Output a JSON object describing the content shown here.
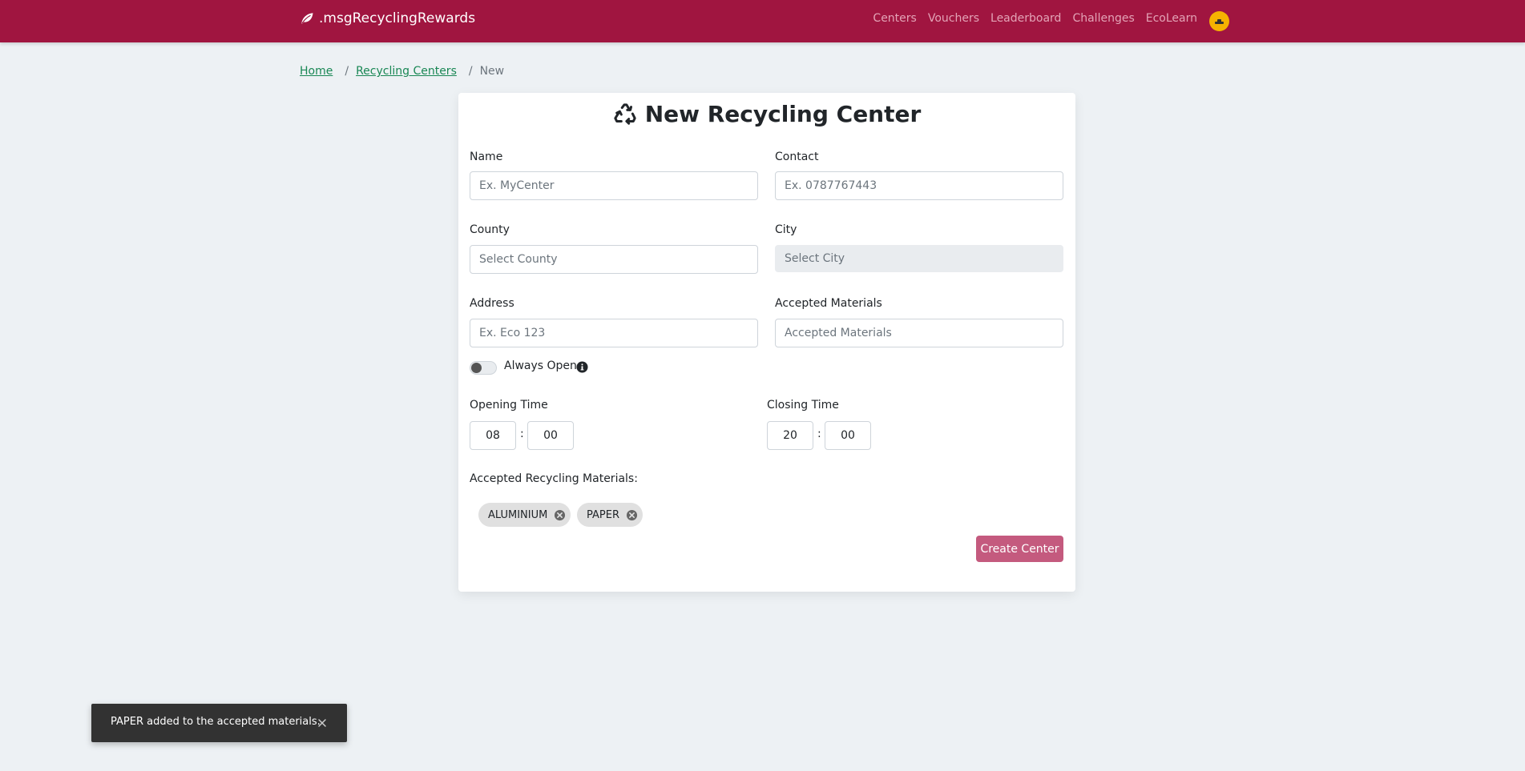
{
  "navbar": {
    "brand": ".msgRecyclingRewards",
    "brand_icon": "leaf-icon",
    "links": [
      "Centers",
      "Vouchers",
      "Leaderboard",
      "Challenges",
      "EcoLearn"
    ],
    "avatar_icon": "avatar-icon",
    "colors": {
      "background": "#a01540",
      "link": "#e3a3b6",
      "avatar": "#f5b301"
    }
  },
  "breadcrumb": {
    "items": [
      "Home",
      "Recycling Centers"
    ],
    "separator": "/",
    "current": "New"
  },
  "form": {
    "title": "New Recycling Center",
    "title_icon": "recycle-icon",
    "fields": {
      "name": {
        "label": "Name",
        "placeholder": "Ex. MyCenter"
      },
      "contact": {
        "label": "Contact",
        "placeholder": "Ex. 0787767443"
      },
      "county": {
        "label": "County",
        "placeholder": "Select County"
      },
      "city": {
        "label": "City",
        "placeholder": "Select City"
      },
      "address": {
        "label": "Address",
        "placeholder": "Ex. Eco 123"
      },
      "materials": {
        "label": "Accepted Materials",
        "placeholder": "Accepted Materials"
      }
    },
    "always_open": {
      "label": "Always Open",
      "checked": false
    },
    "opening_time": {
      "label": "Opening Time",
      "hours": "08",
      "minutes": "00"
    },
    "closing_time": {
      "label": "Closing Time",
      "hours": "20",
      "minutes": "00"
    },
    "time_separator": ":",
    "materials_heading": "Accepted Recycling Materials:",
    "chips": [
      "ALUMINIUM",
      "PAPER"
    ],
    "submit_label": "Create Center",
    "submit_color": "#c45a7e"
  },
  "snackbar": {
    "message": "PAPER added to the accepted materials.",
    "close_icon": "close-icon"
  }
}
